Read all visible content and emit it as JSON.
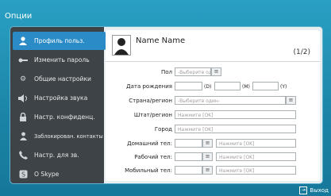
{
  "window": {
    "title": "Опции"
  },
  "sidebar": {
    "items": [
      {
        "label": "Профиль польз.",
        "icon": "user-icon"
      },
      {
        "label": "Изменить пароль",
        "icon": "key-icon"
      },
      {
        "label": "Общие настройки",
        "icon": "gear-icon"
      },
      {
        "label": "Настройка звука",
        "icon": "speaker-icon"
      },
      {
        "label": "Настр. конфиденц.",
        "icon": "lock-icon"
      },
      {
        "label": "Заблокирован. контакты",
        "icon": "blocked-contact-icon"
      },
      {
        "label": "Настр. для зв.",
        "icon": "call-icon"
      },
      {
        "label": "О Skype",
        "icon": "skype-icon"
      }
    ]
  },
  "profile": {
    "name": "Name Name",
    "pager": "(1/2)",
    "gender_label": "Пол",
    "gender_value": "-Выберите один-",
    "birth_label": "Дата рождения",
    "day_suffix": "(D)",
    "month_suffix": "(M)",
    "year_suffix": "(Y)",
    "country_label": "Страна/регион",
    "country_value": "-Выберите один-",
    "state_label": "Штат/регион",
    "state_placeholder": "Нажмите [OK]",
    "city_label": "Город",
    "city_placeholder": "Нажмите [OK]",
    "home_label": "Домашний тел:",
    "home_placeholder": "Нажмите [OK]",
    "work_label": "Рабочий тел:",
    "work_placeholder": "Нажмите [OK]",
    "mobile_label": "Мобильный тел:",
    "mobile_placeholder": "Нажмите [OK]"
  },
  "footer": {
    "exit_label": "Выход"
  },
  "colors": {
    "accent": "#2a8bc6",
    "background": "#1b84a6",
    "sidebar": "#3d4347"
  }
}
